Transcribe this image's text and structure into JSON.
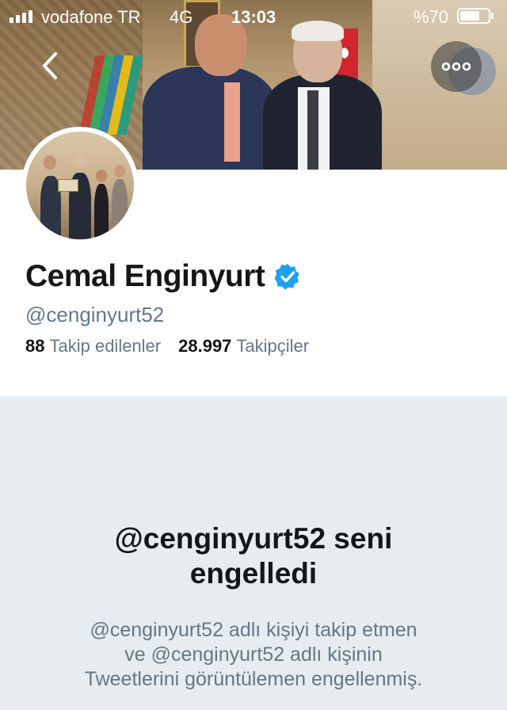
{
  "status_bar": {
    "carrier": "vodafone TR",
    "network": "4G",
    "time": "13:03",
    "battery_percent": "%70",
    "battery_level": 0.7
  },
  "header": {
    "back_icon": "chevron-left-icon",
    "more_icon": "more-horizontal-icon"
  },
  "profile": {
    "name": "Cemal Enginyurt",
    "verified": true,
    "handle": "@cenginyurt52",
    "following_count": "88",
    "following_label": "Takip edilenler",
    "followers_count": "28.997",
    "followers_label": "Takipçiler"
  },
  "blocked": {
    "title_line1": "@cenginyurt52 seni",
    "title_line2": "engelledi",
    "desc_line1": "@cenginyurt52 adlı kişiyi takip etmen",
    "desc_line2": "ve @cenginyurt52 adlı kişinin",
    "desc_line3": "Tweetlerini görüntülemen engellenmiş."
  },
  "colors": {
    "verified_blue": "#1da1f2",
    "text_primary": "#14171a",
    "text_secondary": "#657786",
    "blocked_bg": "#e6ecf0"
  }
}
